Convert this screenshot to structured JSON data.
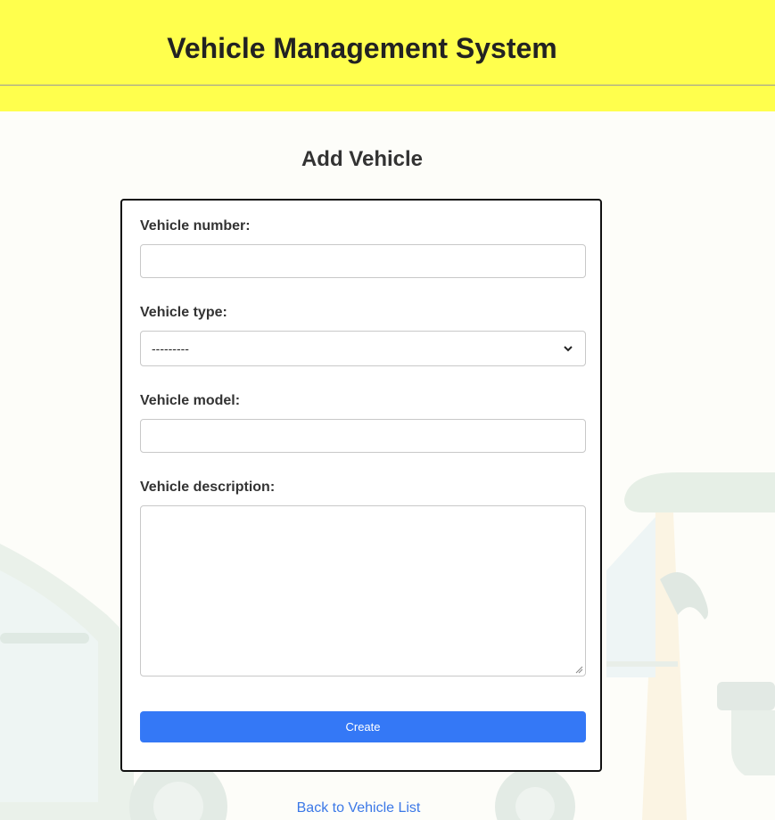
{
  "header": {
    "title": "Vehicle Management System"
  },
  "page": {
    "title": "Add Vehicle"
  },
  "form": {
    "vehicle_number": {
      "label": "Vehicle number:",
      "value": ""
    },
    "vehicle_type": {
      "label": "Vehicle type:",
      "selected": "---------"
    },
    "vehicle_model": {
      "label": "Vehicle model:",
      "value": ""
    },
    "vehicle_description": {
      "label": "Vehicle description:",
      "value": ""
    },
    "submit_label": "Create"
  },
  "links": {
    "back": "Back to Vehicle List"
  },
  "colors": {
    "header_bg": "#ffff4d",
    "accent": "#3478f6",
    "link": "#3b78e7"
  }
}
